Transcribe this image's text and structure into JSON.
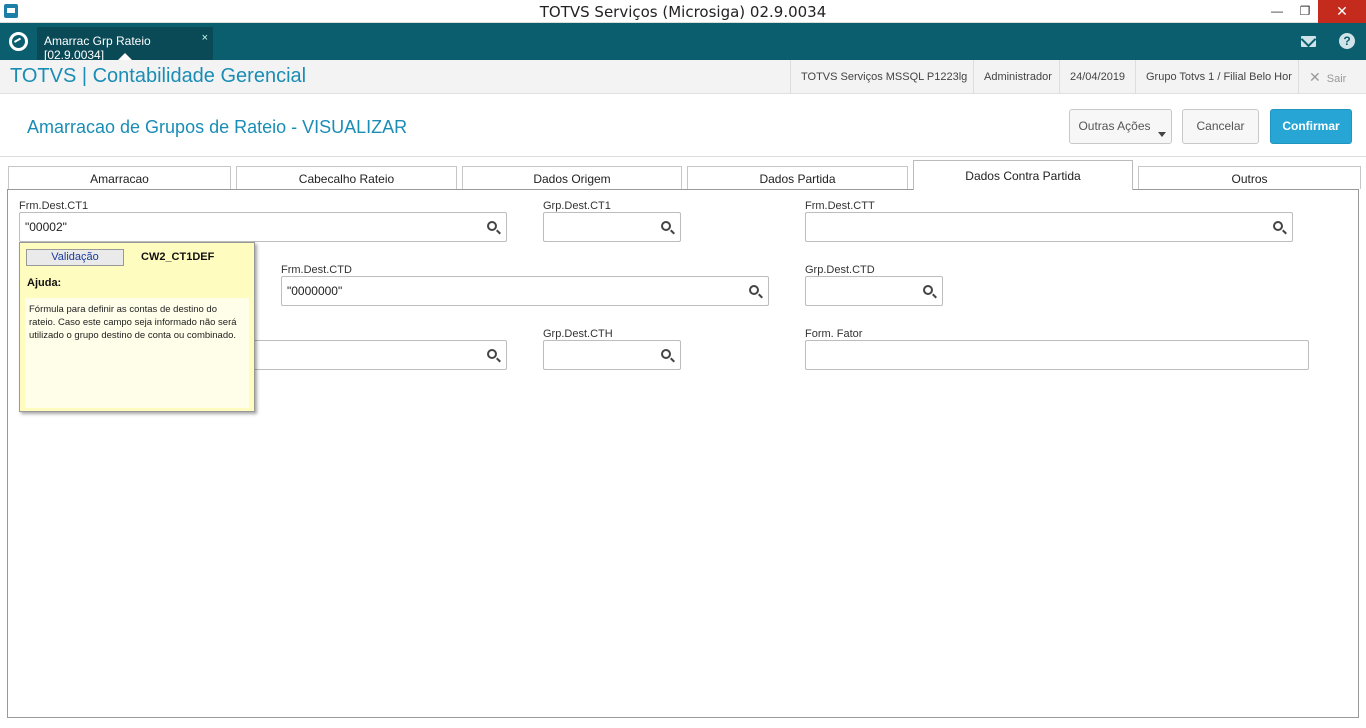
{
  "window": {
    "title": "TOTVS Serviços (Microsiga) 02.9.0034"
  },
  "app_tabs": {
    "active_doc": "Amarrac Grp Rateio [02.9.0034]",
    "close": "×"
  },
  "header": {
    "module_title": "TOTVS | Contabilidade Gerencial",
    "server": "TOTVS Serviços MSSQL P1223lg",
    "user": "Administrador",
    "date": "24/04/2019",
    "branch": "Grupo Totvs 1 / Filial Belo Hor",
    "exit": "Sair"
  },
  "form": {
    "title": "Amarracao de Grupos de Rateio - VISUALIZAR",
    "outras_acoes": "Outras Ações",
    "cancel": "Cancelar",
    "confirm": "Confirmar"
  },
  "tabs": [
    "Amarracao",
    "Cabecalho Rateio",
    "Dados Origem",
    "Dados Partida",
    "Dados Contra Partida",
    "Outros"
  ],
  "fields": {
    "frm_ct1": {
      "label": "Frm.Dest.CT1",
      "value": "\"00002\""
    },
    "grp_ct1": {
      "label": "Grp.Dest.CT1",
      "value": ""
    },
    "frm_ctt": {
      "label": "Frm.Dest.CTT",
      "value": ""
    },
    "frm_ctd": {
      "label": "Frm.Dest.CTD",
      "value": "\"0000000\""
    },
    "grp_ctd": {
      "label": "Grp.Dest.CTD",
      "value": ""
    },
    "frm_cth": {
      "value": ""
    },
    "grp_cth": {
      "label": "Grp.Dest.CTH",
      "value": ""
    },
    "form_fator": {
      "label": "Form. Fator",
      "value": ""
    }
  },
  "tooltip": {
    "validation": "Validação",
    "field_id": "CW2_CT1DEF",
    "help_label": "Ajuda:",
    "help_text": "Fórmula para definir as contas de destino do rateio. Caso este campo seja informado não será utilizado o grupo destino de conta ou combinado."
  },
  "colors": {
    "accent": "#1a8db5",
    "tabbar": "#0b5e6e",
    "confirm": "#27a6d6",
    "tooltip": "#fffcc0"
  }
}
